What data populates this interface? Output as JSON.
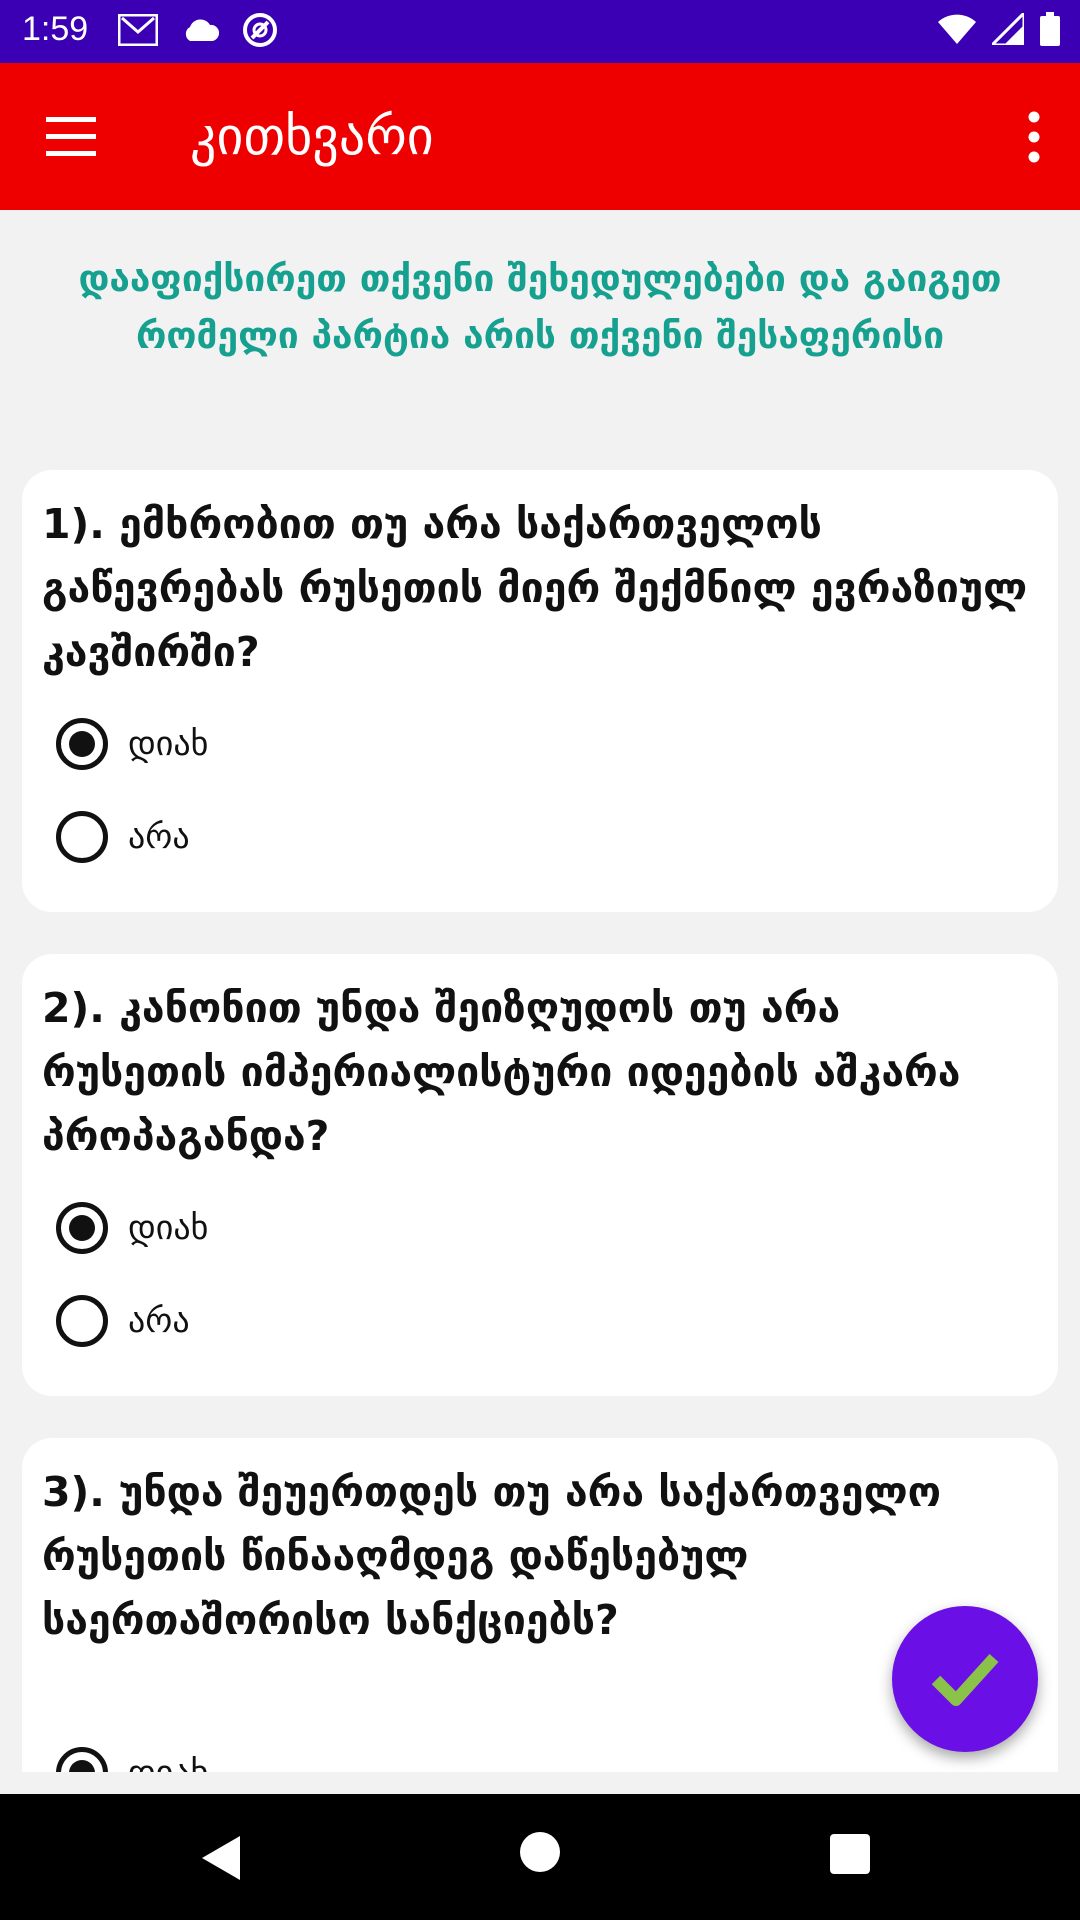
{
  "status_bar": {
    "time": "1:59",
    "left_icons": [
      "gmail-icon",
      "cloud-icon",
      "vpn-icon"
    ],
    "right_icons": [
      "wifi-icon",
      "signal-icon",
      "battery-icon"
    ],
    "color": "#3c00b4"
  },
  "app_bar": {
    "title": "კითხვარი",
    "color": "#ee0000"
  },
  "intro": {
    "text": "დააფიქსირეთ თქვენი შეხედულებები და გაიგეთ რომელი პარტია არის თქვენი შესაფერისი",
    "color": "#16a08f"
  },
  "questions": [
    {
      "text": "1). ემხრობით თუ არა საქართველოს გაწევრებას რუსეთის მიერ შექმნილ ევრაზიულ კავშირში?",
      "options": [
        {
          "label": "დიახ",
          "selected": true
        },
        {
          "label": "არა",
          "selected": false
        }
      ]
    },
    {
      "text": "2). კანონით უნდა შეიზღუდოს თუ არა რუსეთის იმპერიალისტური იდეების აშკარა პროპაგანდა?",
      "options": [
        {
          "label": "დიახ",
          "selected": true
        },
        {
          "label": "არა",
          "selected": false
        }
      ]
    },
    {
      "text": "3). უნდა შეუერთდეს თუ არა საქართველო რუსეთის წინააღმდეგ დაწესებულ საერთაშორისო სანქციებს?",
      "options": [
        {
          "label": "დიახ",
          "selected": true
        }
      ]
    }
  ],
  "fab": {
    "icon": "checkmark-icon",
    "color": "#6a0fe6",
    "check_color": "#8bc34a"
  },
  "nav_bar": {
    "icons": [
      "back-icon",
      "home-icon",
      "recents-icon"
    ]
  }
}
